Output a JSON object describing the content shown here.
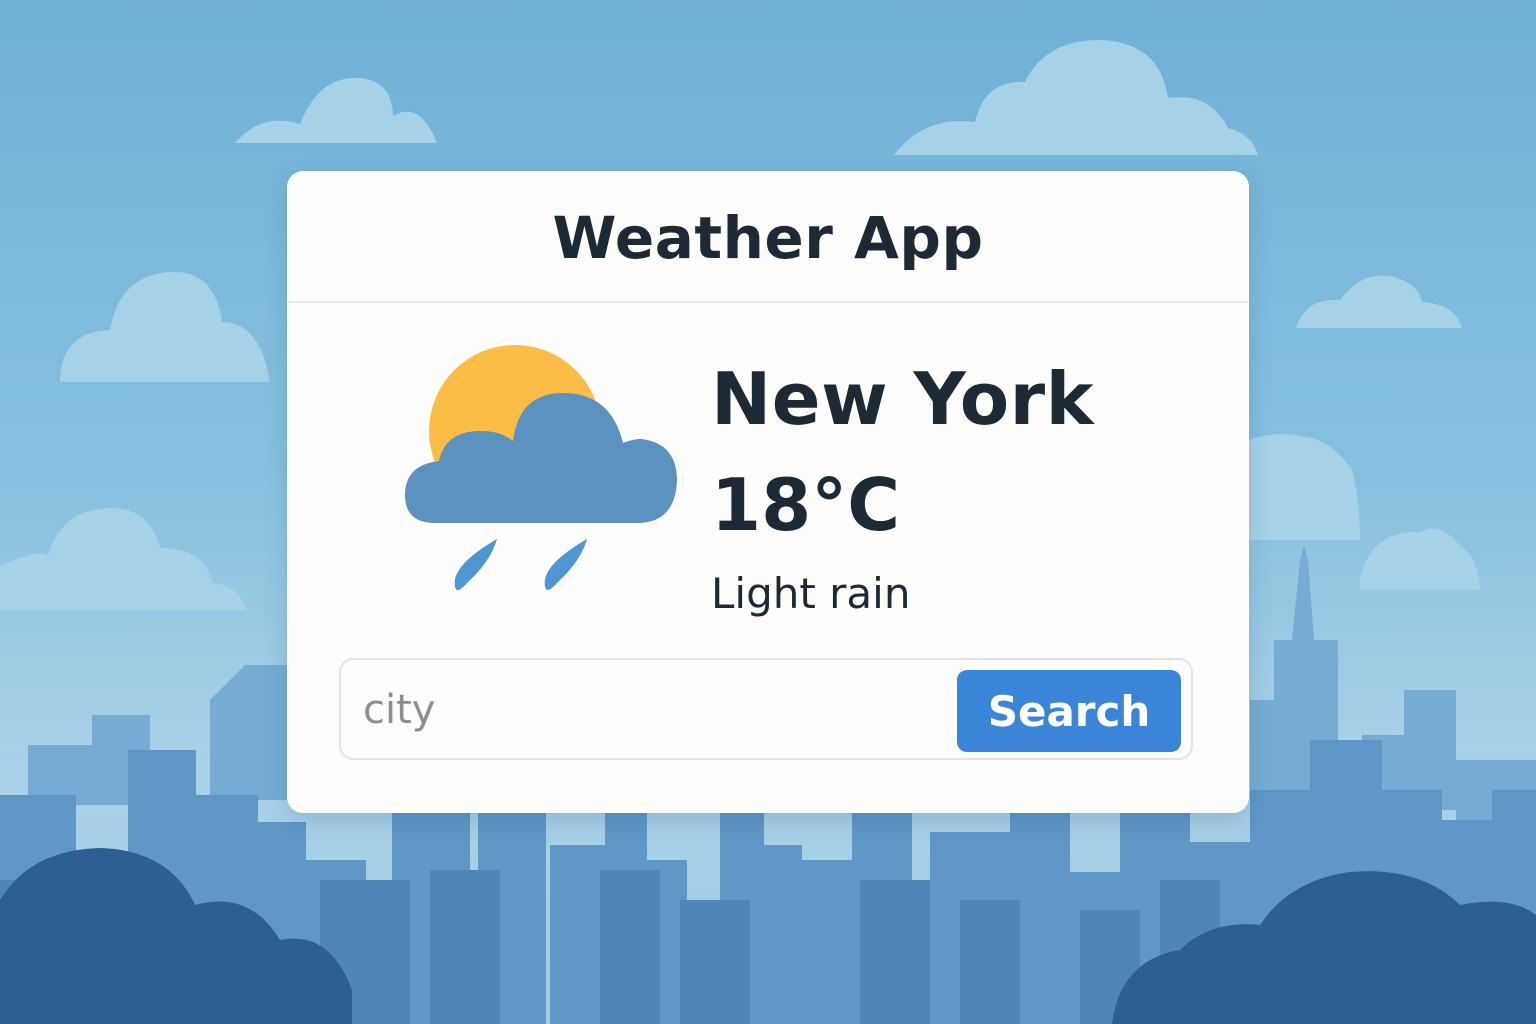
{
  "app": {
    "title": "Weather App"
  },
  "weather": {
    "city": "New York",
    "temperature": "18°C",
    "condition": "Light rain",
    "icon": "sun-cloud-rain-icon"
  },
  "search": {
    "placeholder": "city",
    "value": "",
    "button_label": "Search"
  },
  "colors": {
    "accent": "#3a85d8",
    "sun": "#fbbd45",
    "cloud": "#5b92bf",
    "raindrop": "#4f97d3",
    "sky": "#86c0df",
    "card": "#fdfdfb",
    "text": "#1d2a36"
  }
}
